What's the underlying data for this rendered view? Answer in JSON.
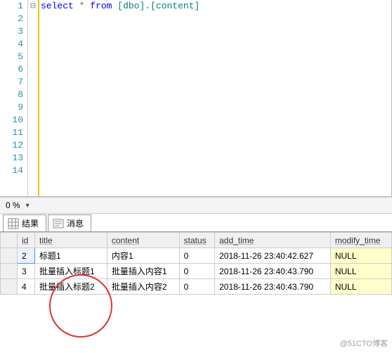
{
  "editor": {
    "line_count": 14,
    "fold_marker": "⊟",
    "code_tokens": {
      "select": "select",
      "star": "*",
      "from": "from",
      "obj": "[dbo].[content]"
    }
  },
  "zoom": {
    "value": "0 %"
  },
  "tabs": {
    "results": "结果",
    "messages": "消息"
  },
  "grid": {
    "columns": [
      "id",
      "title",
      "content",
      "status",
      "add_time",
      "modify_time"
    ],
    "rows": [
      {
        "rownum": "",
        "id": "2",
        "title": "标题1",
        "content": "内容1",
        "status": "0",
        "add_time": "2018-11-26 23:40:42.627",
        "modify_time": "NULL"
      },
      {
        "rownum": "",
        "id": "3",
        "title": "批量插入标题1",
        "content": "批量插入内容1",
        "status": "0",
        "add_time": "2018-11-26 23:40:43.790",
        "modify_time": "NULL"
      },
      {
        "rownum": "",
        "id": "4",
        "title": "批量插入标题2",
        "content": "批量插入内容2",
        "status": "0",
        "add_time": "2018-11-26 23:40:43.790",
        "modify_time": "NULL"
      }
    ]
  },
  "watermark": "@51CTO博客"
}
